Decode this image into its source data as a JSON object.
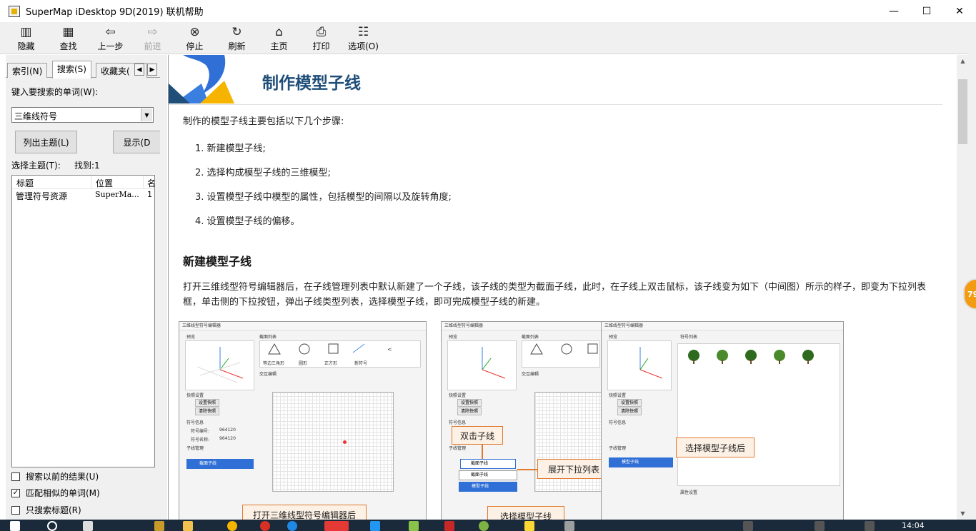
{
  "window": {
    "title": "SuperMap iDesktop 9D(2019) 联机帮助",
    "minimize": "—",
    "maximize": "☐",
    "close": "✕"
  },
  "toolbar": {
    "hide": "隐藏",
    "find": "查找",
    "back": "上一步",
    "forward": "前进",
    "stop": "停止",
    "refresh": "刷新",
    "home": "主页",
    "print": "打印",
    "options": "选项(O)"
  },
  "left": {
    "tabs": [
      "索引(N)",
      "搜索(S)",
      "收藏夹("
    ],
    "keyword_label": "键入要搜索的单词(W):",
    "keyword_value": "三维线符号",
    "list_topics": "列出主题(L)",
    "display": "显示(D",
    "select_topic": "选择主题(T):",
    "found": "找到:1",
    "columns": [
      "标题",
      "位置",
      "名"
    ],
    "rows": [
      {
        "title": "管理符号资源",
        "location": "SuperMa...",
        "rank": "1"
      }
    ],
    "options": [
      {
        "label": "搜索以前的结果(U)",
        "checked": false
      },
      {
        "label": "匹配相似的单词(M)",
        "checked": true
      },
      {
        "label": "只搜索标题(R)",
        "checked": false
      }
    ]
  },
  "content": {
    "title": "制作模型子线",
    "intro": "制作的模型子线主要包括以下几个步骤:",
    "steps": [
      "1.  新建模型子线;",
      "2.  选择构成模型子线的三维模型;",
      "3.  设置模型子线中模型的属性，包括模型的间隔以及旋转角度;",
      "4.  设置模型子线的偏移。"
    ],
    "section_title": "新建模型子线",
    "section_para": "打开三维线型符号编辑器后，在子线管理列表中默认新建了一个子线，该子线的类型为截面子线，此时，在子线上双击鼠标，该子线变为如下（中间图）所示的样子，即变为下拉列表框，单击侧的下拉按钮，弹出子线类型列表，选择模型子线，即可完成模型子线的新建。",
    "figure": {
      "shot_title": "三维线型符号编辑器",
      "preview": "预览",
      "section_list": "截面列表",
      "symbol_list": "符号列表",
      "cross_edit": "交互编辑",
      "quick_set": "快照设置",
      "set_snap": "设置快照",
      "clear_snap": "清除快照",
      "symbol_info": "符号信息",
      "symbol_id": "符号编号:",
      "symbol_id_val": "964120",
      "symbol_name": "符号名称:",
      "symbol_name_val": "964120",
      "subline_mgmt": "子线管理",
      "section_subline": "截面子线",
      "model_subline": "模型子线",
      "attr_set": "属性设置",
      "shapes": [
        "等边三角形",
        "圆形",
        "正方形",
        "新符号"
      ],
      "callouts": {
        "open_editor": "打开三维线型符号编辑器后",
        "double_click": "双击子线",
        "expand_list": "展开下拉列表",
        "select_model": "选择模型子线",
        "after_select": "选择模型子线后"
      }
    }
  },
  "badge": "79",
  "taskbar": {
    "clock": "14:04"
  }
}
